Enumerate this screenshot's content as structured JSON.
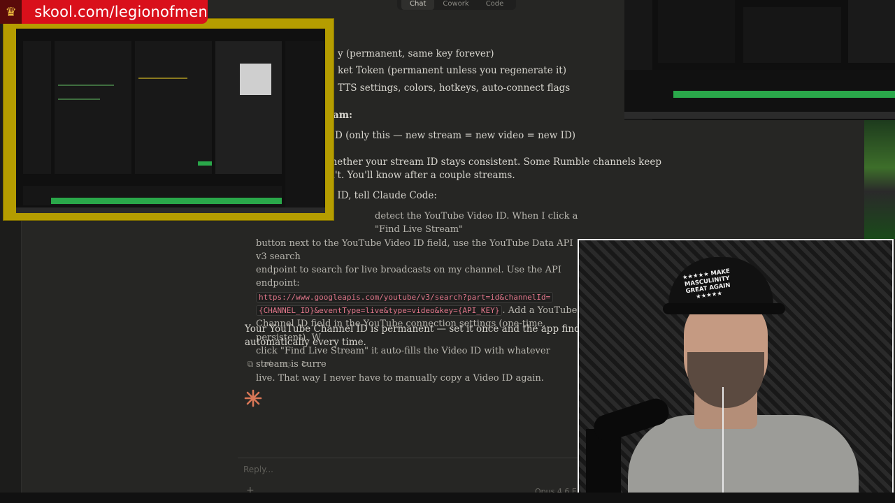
{
  "banner": {
    "text": "skool.com/legionofmen"
  },
  "mode_tabs": [
    "Chat",
    "Cowork",
    "Code"
  ],
  "chat": {
    "bullets": [
      "y (permanent, same key forever)",
      "ket Token (permanent unless you regenerate it)",
      "TTS settings, colors, hotkeys, auto-connect flags"
    ],
    "heading": "am:",
    "bullet_video": "D (only this — new stream = new video = new ID)",
    "para1_l1": "whether your stream ID stays consistent. Some Rumble channels keep",
    "para1_l2": "on't. You'll know after a couple streams.",
    "para2": "eo ID, tell Claude Code:",
    "prompt": {
      "l1": "detect the YouTube Video ID. When I click a \"Find Live Stream\"",
      "l2": "button next to the YouTube Video ID field, use the YouTube Data API v3 search",
      "l3": "endpoint to search for live broadcasts on my channel. Use the API endpoint:",
      "code1": "https://www.googleapis.com/youtube/v3/search?part=id&channelId=",
      "code2": "{CHANNEL_ID}&eventType=live&type=video&key={API_KEY}",
      "l4_tail": ". Add a YouTube",
      "l5": "Channel ID field in the YouTube connection settings (one-time, persistent). W",
      "l6": "click \"Find Live Stream\" it auto-fills the Video ID with whatever stream is curre",
      "l7": "live. That way I never have to manually copy a Video ID again."
    },
    "final_l1": "Your YouTube Channel ID is permanent — set it once and the app finds your live s",
    "final_l2": "automatically every time."
  },
  "reply": {
    "placeholder": "Reply...",
    "model": "Opus 4.6  E"
  },
  "webcam": {
    "cap_text": "★★★★★ MAKE MASCULINITY GREAT AGAIN ★★★★★"
  },
  "colors": {
    "banner": "#d9101b",
    "accent": "#d97757",
    "code": "#e0768a"
  }
}
